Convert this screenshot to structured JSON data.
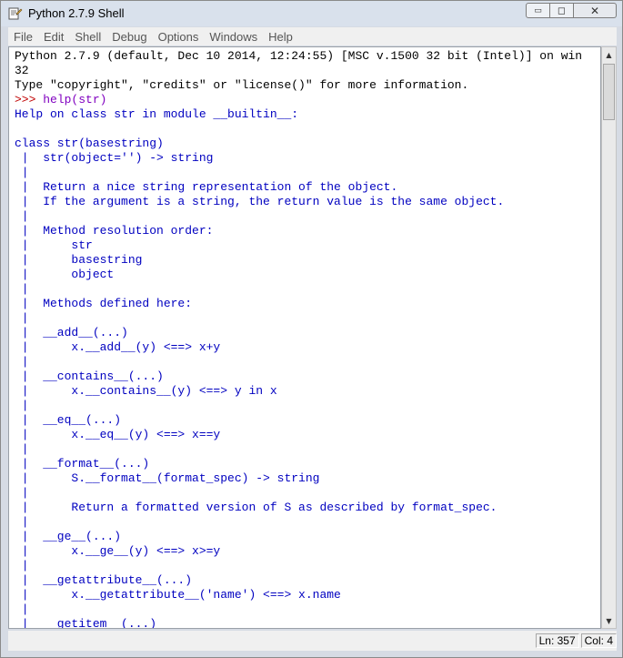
{
  "window": {
    "title": "Python 2.7.9 Shell",
    "controls": {
      "minimize": "▭",
      "maximize": "◻",
      "close": "✕"
    }
  },
  "menubar": {
    "items": [
      "File",
      "Edit",
      "Shell",
      "Debug",
      "Options",
      "Windows",
      "Help"
    ]
  },
  "shell": {
    "lines": [
      {
        "text": "Python 2.7.9 (default, Dec 10 2014, 12:24:55) [MSC v.1500 32 bit (Intel)] on win",
        "color": "black"
      },
      {
        "text": "32",
        "color": "black"
      },
      {
        "text": "Type \"copyright\", \"credits\" or \"license()\" for more information.",
        "color": "black"
      },
      {
        "text": ">>> ",
        "color": "red",
        "rest": "help(str)",
        "rest_color": "purple"
      },
      {
        "text": "Help on class str in module __builtin__:",
        "color": "blue"
      },
      {
        "text": "",
        "color": "blue"
      },
      {
        "text": "class str(basestring)",
        "color": "blue"
      },
      {
        "text": " |  str(object='') -> string",
        "color": "blue"
      },
      {
        "text": " |  ",
        "color": "blue"
      },
      {
        "text": " |  Return a nice string representation of the object.",
        "color": "blue"
      },
      {
        "text": " |  If the argument is a string, the return value is the same object.",
        "color": "blue"
      },
      {
        "text": " |  ",
        "color": "blue"
      },
      {
        "text": " |  Method resolution order:",
        "color": "blue"
      },
      {
        "text": " |      str",
        "color": "blue"
      },
      {
        "text": " |      basestring",
        "color": "blue"
      },
      {
        "text": " |      object",
        "color": "blue"
      },
      {
        "text": " |  ",
        "color": "blue"
      },
      {
        "text": " |  Methods defined here:",
        "color": "blue"
      },
      {
        "text": " |  ",
        "color": "blue"
      },
      {
        "text": " |  __add__(...)",
        "color": "blue"
      },
      {
        "text": " |      x.__add__(y) <==> x+y",
        "color": "blue"
      },
      {
        "text": " |  ",
        "color": "blue"
      },
      {
        "text": " |  __contains__(...)",
        "color": "blue"
      },
      {
        "text": " |      x.__contains__(y) <==> y in x",
        "color": "blue"
      },
      {
        "text": " |  ",
        "color": "blue"
      },
      {
        "text": " |  __eq__(...)",
        "color": "blue"
      },
      {
        "text": " |      x.__eq__(y) <==> x==y",
        "color": "blue"
      },
      {
        "text": " |  ",
        "color": "blue"
      },
      {
        "text": " |  __format__(...)",
        "color": "blue"
      },
      {
        "text": " |      S.__format__(format_spec) -> string",
        "color": "blue"
      },
      {
        "text": " |      ",
        "color": "blue"
      },
      {
        "text": " |      Return a formatted version of S as described by format_spec.",
        "color": "blue"
      },
      {
        "text": " |  ",
        "color": "blue"
      },
      {
        "text": " |  __ge__(...)",
        "color": "blue"
      },
      {
        "text": " |      x.__ge__(y) <==> x>=y",
        "color": "blue"
      },
      {
        "text": " |  ",
        "color": "blue"
      },
      {
        "text": " |  __getattribute__(...)",
        "color": "blue"
      },
      {
        "text": " |      x.__getattribute__('name') <==> x.name",
        "color": "blue"
      },
      {
        "text": " |  ",
        "color": "blue"
      },
      {
        "text": " |  __getitem__(...)",
        "color": "blue"
      }
    ]
  },
  "statusbar": {
    "line": "Ln: 357",
    "col": "Col: 4"
  },
  "colors": {
    "blue": "#0000c0",
    "red": "#c00000",
    "purple": "#8000c0",
    "black": "#000000"
  }
}
